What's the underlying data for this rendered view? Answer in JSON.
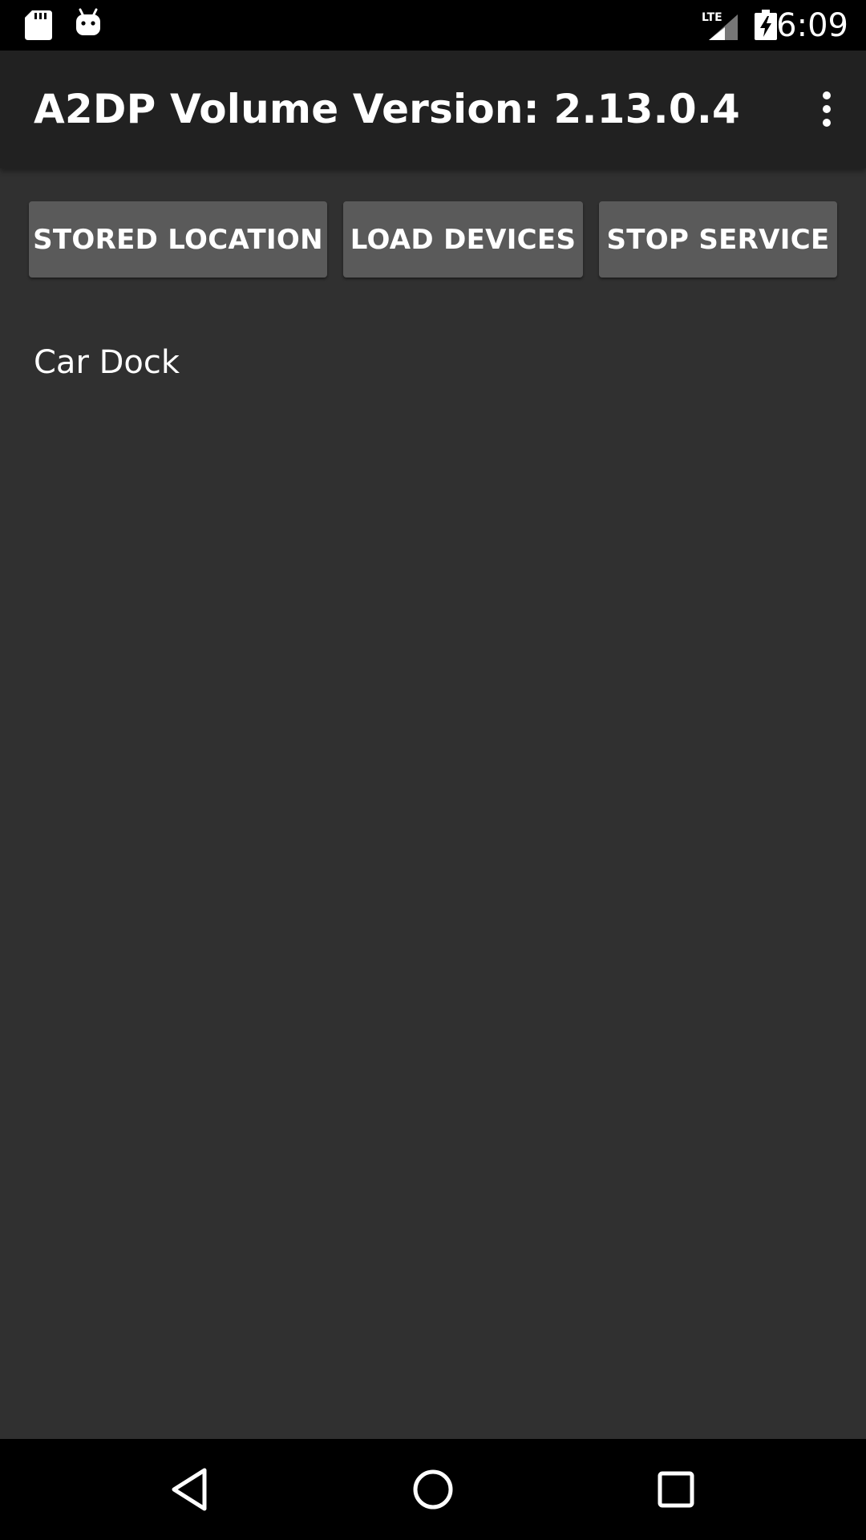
{
  "status_bar": {
    "time": "6:09",
    "network_label": "LTE",
    "icons": [
      "sd-card-icon",
      "android-debug-icon",
      "lte-signal-icon",
      "battery-charging-icon"
    ]
  },
  "action_bar": {
    "title": "A2DP Volume Version: 2.13.0.4",
    "overflow_icon": "more-vert-icon"
  },
  "buttons": {
    "stored_location": "STORED LOCATION",
    "load_devices": "LOAD DEVICES",
    "stop_service": "STOP SERVICE"
  },
  "devices": [
    {
      "label": "Car Dock"
    }
  ],
  "nav_bar": {
    "icons": [
      "back-icon",
      "home-icon",
      "recents-icon"
    ]
  },
  "colors": {
    "background": "#303030",
    "action_bar": "#212121",
    "button": "#5a5a5a",
    "system_bars": "#000000",
    "text": "#ffffff"
  }
}
